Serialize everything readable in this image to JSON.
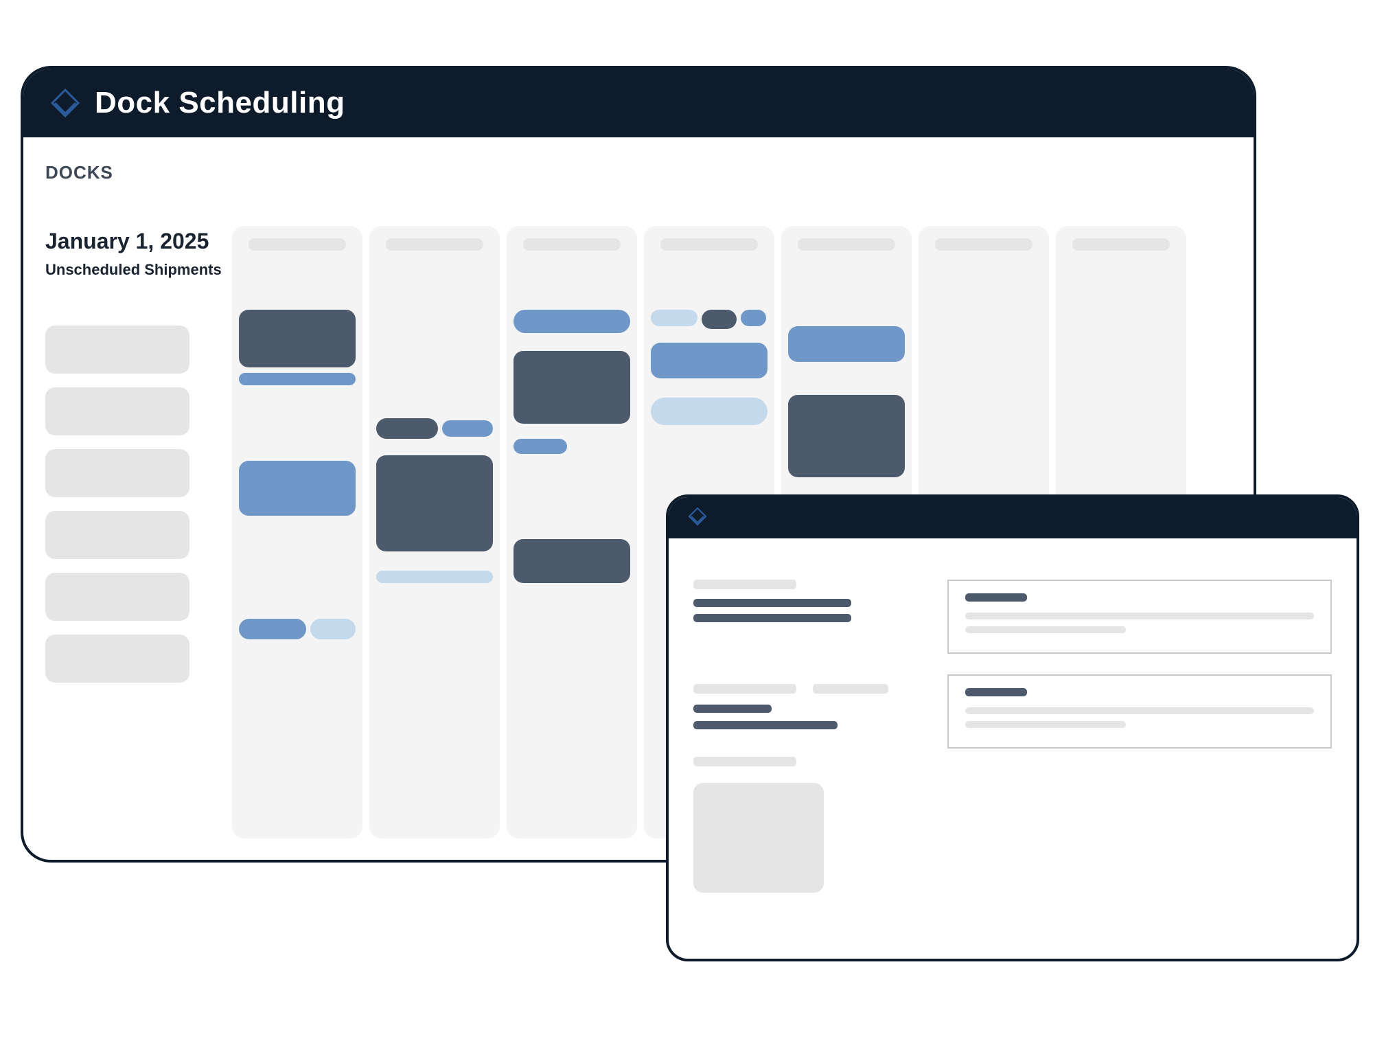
{
  "colors": {
    "header_bg": "#0d1b2a",
    "logo_stroke": "#2b5b9a",
    "block_dark": "#4d5a6b",
    "block_mid": "#6f97c8",
    "block_light": "#c5d9ec",
    "gray_light": "#e5e5e5",
    "col_bg": "#f4f4f4"
  },
  "main_window": {
    "title": "Dock Scheduling",
    "section_label": "DOCKS",
    "date": "January 1, 2025",
    "unscheduled_label": "Unscheduled Shipments",
    "unscheduled_count": 6,
    "column_count": 7
  },
  "detail_window": {
    "has_title": false
  }
}
